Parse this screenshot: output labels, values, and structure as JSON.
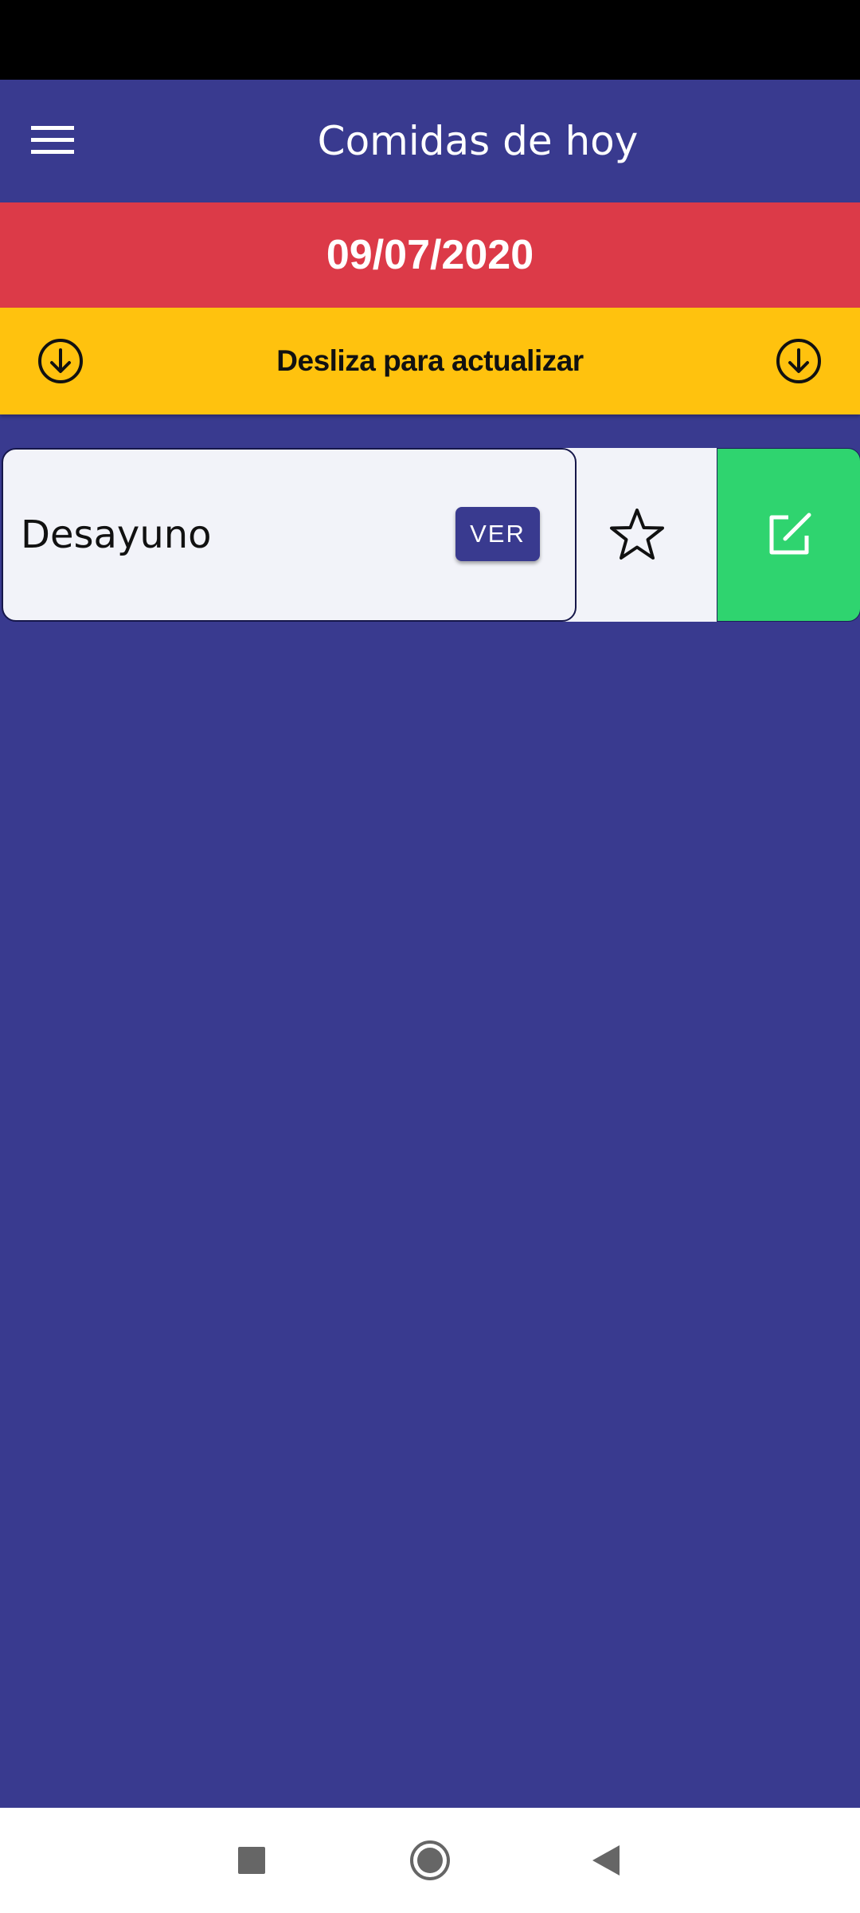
{
  "app_bar": {
    "title": "Comidas de hoy",
    "menu_icon": "hamburger-menu-icon"
  },
  "date_banner": {
    "date": "09/07/2020",
    "color": "#dc3a48"
  },
  "refresh_banner": {
    "text": "Desliza para actualizar",
    "icon": "arrow-down-circle-icon",
    "color": "#ffc20e"
  },
  "meals": [
    {
      "name": "Desayuno",
      "view_label": "VER",
      "favorite_icon": "star-outline-icon",
      "edit_icon": "edit-icon",
      "edit_color": "#2fd46f"
    }
  ],
  "nav_bar": {
    "icons": [
      "recents-square-icon",
      "home-circle-icon",
      "back-triangle-icon"
    ]
  },
  "colors": {
    "primary": "#393a8f",
    "card_background": "#f2f3f9"
  }
}
